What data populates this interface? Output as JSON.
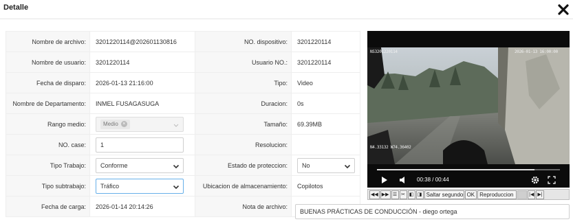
{
  "dialog": {
    "title": "Detalle",
    "close_icon": "close-x-icon"
  },
  "fields": {
    "nombre_archivo": {
      "label": "Nombre de archivo:",
      "value": "3201220114@202601130816"
    },
    "no_dispositivo": {
      "label": "NO. dispositivo:",
      "value": "3201220114"
    },
    "nombre_usuario": {
      "label": "Nombre de usuario:",
      "value": "3201220114"
    },
    "usuario_no": {
      "label": "Usuario NO.:",
      "value": "3201220114"
    },
    "fecha_disparo": {
      "label": "Fecha de disparo:",
      "value": "2026-01-13 21:16:00"
    },
    "tipo": {
      "label": "Tipo:",
      "value": "Video"
    },
    "departamento": {
      "label": "Nombre de Departamento:",
      "value": "INMEL FUSAGASUGA"
    },
    "duracion": {
      "label": "Duracion:",
      "value": "0s"
    },
    "rango_medio": {
      "label": "Rango medio:",
      "tag": "Medio"
    },
    "tamano": {
      "label": "Tamaño:",
      "value": "69.39MB"
    },
    "no_case": {
      "label": "NO. case:",
      "value": "1"
    },
    "resolucion": {
      "label": "Resolucion:",
      "value": ""
    },
    "tipo_trabajo": {
      "label": "Tipo Trabajo:",
      "value": "Conforme"
    },
    "estado_proteccion": {
      "label": "Estado de proteccion:",
      "value": "No"
    },
    "tipo_subtrabajo": {
      "label": "Tipo subtrabajo:",
      "value": "Tráfico"
    },
    "ubicacion": {
      "label": "Ubicacion de almacenamiento:",
      "value": "Copilotos"
    },
    "fecha_carga": {
      "label": "Fecha de carga:",
      "value": "2026-01-14 20:14:26"
    },
    "nota_archivo": {
      "label": "Nota de archivo:",
      "value": "BUENAS PRÁCTICAS DE CONDUCCIÓN - diego ortega"
    }
  },
  "video": {
    "osd_top_left": "NS3201220114",
    "osd_top_right": "2026-01-13 16:00:00",
    "osd_bottom_left": "N4.33132 W74.36402",
    "time_display": "00:38 / 00:44",
    "progress_fraction": 0.86
  },
  "toolbar": {
    "saltar_label": "Saltar segundos",
    "ok_label": "OK",
    "reproduccion_label": "Reproduccion"
  }
}
